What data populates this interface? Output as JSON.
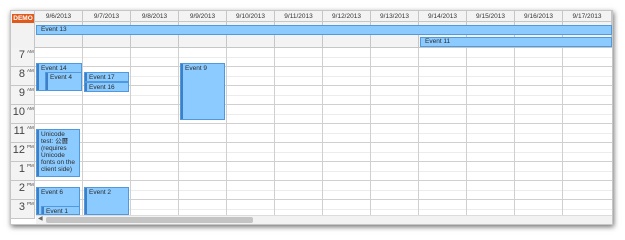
{
  "demo_badge": "DEMO",
  "dates": [
    "9/6/2013",
    "9/7/2013",
    "9/8/2013",
    "9/9/2013",
    "9/10/2013",
    "9/11/2013",
    "9/12/2013",
    "9/13/2013",
    "9/14/2013",
    "9/15/2013",
    "9/16/2013",
    "9/17/2013"
  ],
  "hours": [
    {
      "h": "7",
      "ap": "AM"
    },
    {
      "h": "8",
      "ap": "AM"
    },
    {
      "h": "9",
      "ap": "AM"
    },
    {
      "h": "10",
      "ap": "AM"
    },
    {
      "h": "11",
      "ap": "AM"
    },
    {
      "h": "12",
      "ap": "PM"
    },
    {
      "h": "1",
      "ap": "PM"
    },
    {
      "h": "2",
      "ap": "PM"
    },
    {
      "h": "3",
      "ap": "PM"
    }
  ],
  "all_day_events": [
    {
      "id": "event-13",
      "text": "Event 13"
    },
    {
      "id": "event-11",
      "text": "Event 11"
    }
  ],
  "events": [
    {
      "id": "event-14",
      "text": "Event 14"
    },
    {
      "id": "event-4",
      "text": "Event 4"
    },
    {
      "id": "event-17",
      "text": "Event 17"
    },
    {
      "id": "event-16",
      "text": "Event 16"
    },
    {
      "id": "event-9",
      "text": "Event 9"
    },
    {
      "id": "event-unicode",
      "text": "Unicode test: 公曆 (requires Unicode fonts on the client side)"
    },
    {
      "id": "event-6",
      "text": "Event 6"
    },
    {
      "id": "event-2",
      "text": "Event 2"
    },
    {
      "id": "event-1",
      "text": "Event 1"
    }
  ],
  "colors": {
    "event_fill": "#8ccbff",
    "event_border": "#4f99dc",
    "event_bar": "#3f7fc8",
    "demo_badge": "#e05a1e",
    "header_bg": "#f3f3f3"
  }
}
